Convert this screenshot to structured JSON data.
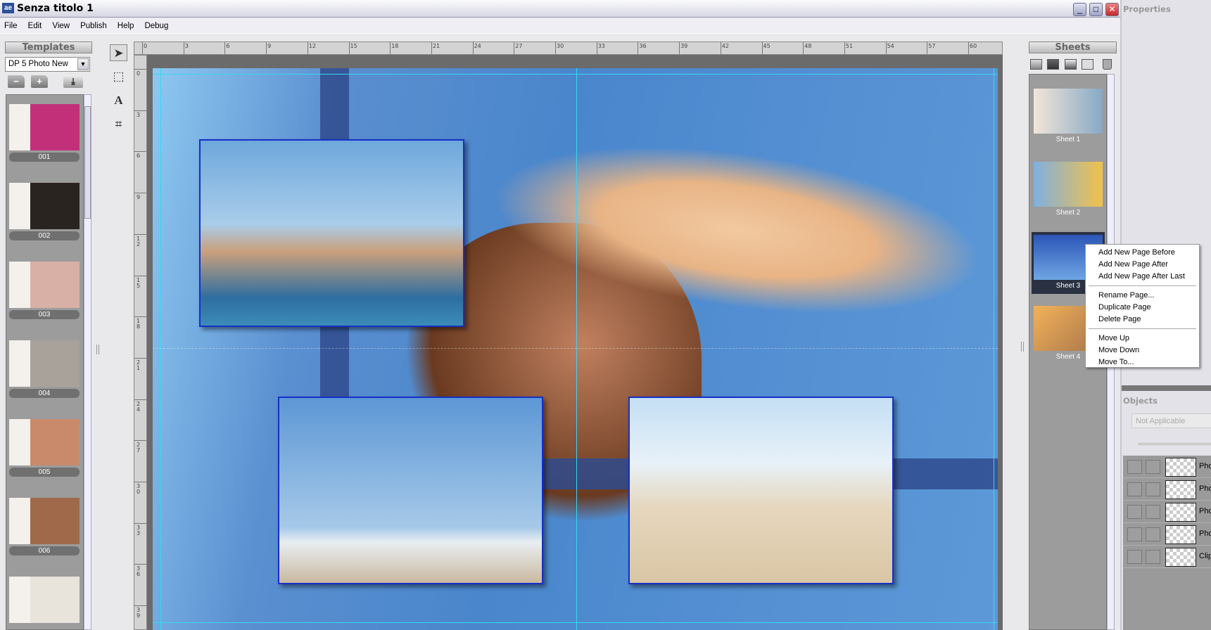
{
  "window": {
    "title": "Senza titolo 1",
    "app_icon": "ae",
    "minimize": "_",
    "maximize": "□",
    "close": "✕"
  },
  "menu": [
    "File",
    "Edit",
    "View",
    "Publish",
    "Help",
    "Debug"
  ],
  "templates": {
    "header": "Templates",
    "selected": "DP 5 Photo New",
    "icons": [
      "remove-folder-icon",
      "add-folder-icon",
      "import-icon"
    ],
    "items": [
      {
        "label": "001",
        "color": "#c2307a"
      },
      {
        "label": "002",
        "color": "#2a2420"
      },
      {
        "label": "003",
        "color": "#d8b0a6"
      },
      {
        "label": "004",
        "color": "#a8a29a"
      },
      {
        "label": "005",
        "color": "#c98a6c"
      },
      {
        "label": "006",
        "color": "#a06a4a"
      },
      {
        "label": "",
        "color": "#e8e4dc"
      }
    ]
  },
  "tools": [
    "select-move-icon",
    "marquee-icon",
    "text-icon",
    "crop-icon"
  ],
  "tool_glyphs": [
    "➤",
    "⬚",
    "A",
    "⌗"
  ],
  "ruler": {
    "horizontal": [
      "0",
      "3",
      "6",
      "9",
      "12",
      "15",
      "18",
      "21",
      "24",
      "27",
      "30",
      "33",
      "36",
      "39",
      "42",
      "45",
      "48",
      "51",
      "54",
      "57",
      "60"
    ],
    "vertical": [
      "0",
      "3",
      "6",
      "9",
      "12",
      "15",
      "18",
      "21",
      "24",
      "27",
      "30",
      "33",
      "36",
      "39"
    ]
  },
  "sheets": {
    "header": "Sheets",
    "icons": [
      "add-sheet-icon",
      "move-back-icon",
      "move-front-icon",
      "duplicate-icon",
      "trash-icon"
    ],
    "items": [
      {
        "label": "Sheet 1",
        "selected": false
      },
      {
        "label": "Sheet 2",
        "selected": false
      },
      {
        "label": "Sheet 3",
        "selected": true
      },
      {
        "label": "Sheet 4",
        "selected": false
      }
    ]
  },
  "context_menu": {
    "groups": [
      [
        "Add New Page Before",
        "Add New Page After",
        "Add New Page After Last"
      ],
      [
        "Rename Page...",
        "Duplicate Page",
        "Delete Page"
      ],
      [
        "Move Up",
        "Move Down",
        "Move To..."
      ]
    ]
  },
  "properties": {
    "header": "Properties"
  },
  "objects": {
    "header": "Objects",
    "field": "Not Applicable",
    "rows": [
      "Phot",
      "Phot",
      "Phot",
      "Phot",
      "Clipa"
    ]
  },
  "colors": {
    "accent_guide": "#3ad6f0",
    "photo_border": "#1530c8",
    "stripe": "#2f4b8e"
  }
}
